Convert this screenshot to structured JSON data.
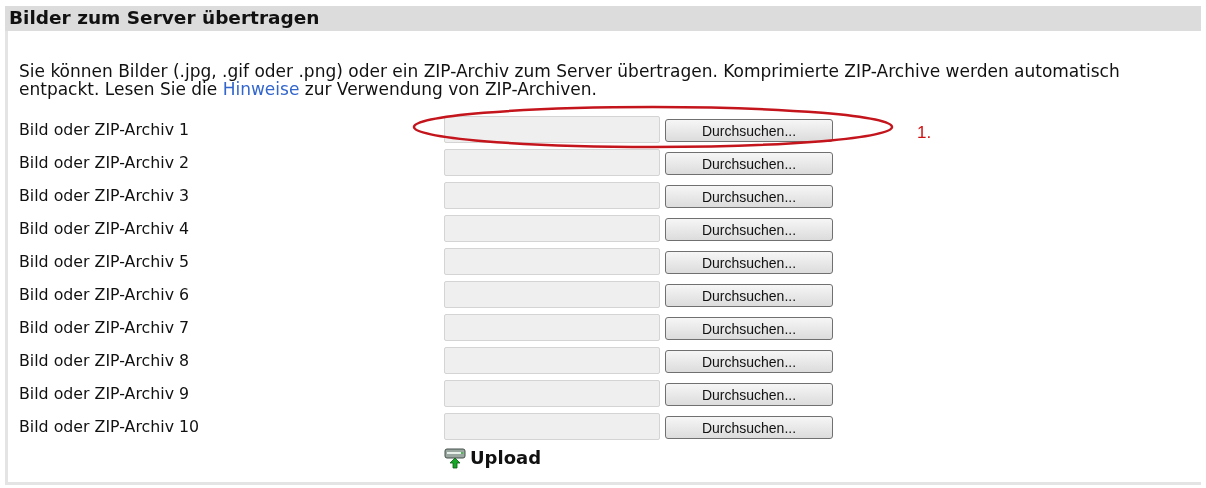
{
  "header": {
    "title": "Bilder zum Server übertragen"
  },
  "intro": {
    "text_before": "Sie können Bilder (.jpg, .gif oder .png) oder ein ZIP-Archiv zum Server übertragen. Komprimierte ZIP-Archive werden automatisch entpackt. Lesen Sie die",
    "link": "Hinweise",
    "text_after": "zur Verwendung von ZIP-Archiven."
  },
  "rows": [
    {
      "label": "Bild oder ZIP-Archiv 1",
      "button": "Durchsuchen...",
      "highlighted": true
    },
    {
      "label": "Bild oder ZIP-Archiv 2",
      "button": "Durchsuchen...",
      "highlighted": false
    },
    {
      "label": "Bild oder ZIP-Archiv 3",
      "button": "Durchsuchen...",
      "highlighted": false
    },
    {
      "label": "Bild oder ZIP-Archiv 4",
      "button": "Durchsuchen...",
      "highlighted": false
    },
    {
      "label": "Bild oder ZIP-Archiv 5",
      "button": "Durchsuchen...",
      "highlighted": false
    },
    {
      "label": "Bild oder ZIP-Archiv 6",
      "button": "Durchsuchen...",
      "highlighted": false
    },
    {
      "label": "Bild oder ZIP-Archiv 7",
      "button": "Durchsuchen...",
      "highlighted": false
    },
    {
      "label": "Bild oder ZIP-Archiv 8",
      "button": "Durchsuchen...",
      "highlighted": false
    },
    {
      "label": "Bild oder ZIP-Archiv 9",
      "button": "Durchsuchen...",
      "highlighted": false
    },
    {
      "label": "Bild oder ZIP-Archiv 10",
      "button": "Durchsuchen...",
      "highlighted": false
    }
  ],
  "annotation": {
    "label": "1."
  },
  "upload_button": {
    "label": "Upload"
  }
}
